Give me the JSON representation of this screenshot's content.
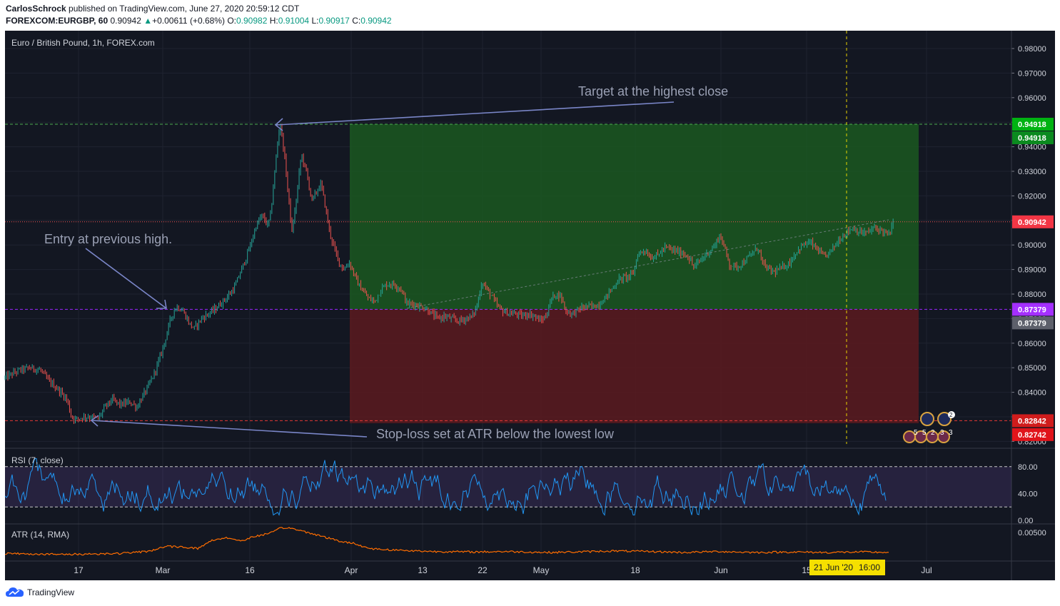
{
  "header": {
    "author": "CarlosSchrock",
    "published_text": "published on TradingView.com, June 27, 2020 20:59:12 CDT",
    "symbol": "FOREXCOM:EURGBP, 60",
    "last": "0.90942",
    "change": "+0.00611 (+0.68%)",
    "o_label": "O:",
    "o_value": "0.90982",
    "h_label": "H:",
    "h_value": "0.91004",
    "l_label": "L:",
    "l_value": "0.90917",
    "c_label": "C:",
    "c_value": "0.90942"
  },
  "chart_data": [
    {
      "type": "candlestick",
      "title": "Euro / British Pound, 1h, FOREX.com",
      "ylim": [
        0.818,
        0.985
      ],
      "y_ticks": [
        "0.98000",
        "0.97000",
        "0.96000",
        "0.95000",
        "0.94000",
        "0.93000",
        "0.92000",
        "0.91000",
        "0.90000",
        "0.89000",
        "0.88000",
        "0.87000",
        "0.86000",
        "0.85000",
        "0.84000",
        "0.83000",
        "0.82000"
      ],
      "x_ticks": [
        "17",
        "Mar",
        "16",
        "Apr",
        "13",
        "22",
        "May",
        "18",
        "Jun",
        "15",
        "Jul"
      ],
      "price_path": [
        [
          0,
          0.846
        ],
        [
          20,
          0.849
        ],
        [
          35,
          0.85
        ],
        [
          50,
          0.849
        ],
        [
          60,
          0.845
        ],
        [
          75,
          0.841
        ],
        [
          87,
          0.837
        ],
        [
          93,
          0.83
        ],
        [
          100,
          0.829
        ],
        [
          110,
          0.83
        ],
        [
          122,
          0.83
        ],
        [
          130,
          0.829
        ],
        [
          140,
          0.834
        ],
        [
          150,
          0.837
        ],
        [
          162,
          0.835
        ],
        [
          175,
          0.836
        ],
        [
          185,
          0.834
        ],
        [
          192,
          0.838
        ],
        [
          200,
          0.842
        ],
        [
          208,
          0.847
        ],
        [
          218,
          0.855
        ],
        [
          225,
          0.862
        ],
        [
          232,
          0.87
        ],
        [
          240,
          0.875
        ],
        [
          250,
          0.873
        ],
        [
          258,
          0.868
        ],
        [
          265,
          0.866
        ],
        [
          275,
          0.87
        ],
        [
          285,
          0.872
        ],
        [
          295,
          0.874
        ],
        [
          305,
          0.877
        ],
        [
          315,
          0.88
        ],
        [
          322,
          0.883
        ],
        [
          330,
          0.889
        ],
        [
          338,
          0.895
        ],
        [
          345,
          0.901
        ],
        [
          352,
          0.908
        ],
        [
          360,
          0.912
        ],
        [
          368,
          0.908
        ],
        [
          372,
          0.912
        ],
        [
          378,
          0.93
        ],
        [
          383,
          0.945
        ],
        [
          386,
          0.949
        ],
        [
          392,
          0.935
        ],
        [
          397,
          0.92
        ],
        [
          402,
          0.905
        ],
        [
          408,
          0.918
        ],
        [
          415,
          0.937
        ],
        [
          422,
          0.93
        ],
        [
          430,
          0.918
        ],
        [
          437,
          0.922
        ],
        [
          443,
          0.925
        ],
        [
          449,
          0.915
        ],
        [
          455,
          0.905
        ],
        [
          462,
          0.898
        ],
        [
          468,
          0.893
        ],
        [
          475,
          0.89
        ],
        [
          482,
          0.893
        ],
        [
          488,
          0.889
        ],
        [
          495,
          0.884
        ],
        [
          502,
          0.881
        ],
        [
          510,
          0.878
        ],
        [
          518,
          0.877
        ],
        [
          527,
          0.882
        ],
        [
          535,
          0.884
        ],
        [
          545,
          0.884
        ],
        [
          555,
          0.882
        ],
        [
          563,
          0.876
        ],
        [
          572,
          0.876
        ],
        [
          582,
          0.875
        ],
        [
          590,
          0.874
        ],
        [
          598,
          0.872
        ],
        [
          606,
          0.87
        ],
        [
          616,
          0.871
        ],
        [
          625,
          0.87
        ],
        [
          635,
          0.869
        ],
        [
          645,
          0.87
        ],
        [
          655,
          0.871
        ],
        [
          662,
          0.876
        ],
        [
          668,
          0.885
        ],
        [
          675,
          0.882
        ],
        [
          682,
          0.879
        ],
        [
          690,
          0.875
        ],
        [
          698,
          0.873
        ],
        [
          707,
          0.872
        ],
        [
          716,
          0.872
        ],
        [
          724,
          0.871
        ],
        [
          733,
          0.872
        ],
        [
          742,
          0.871
        ],
        [
          750,
          0.869
        ],
        [
          758,
          0.871
        ],
        [
          765,
          0.878
        ],
        [
          772,
          0.88
        ],
        [
          779,
          0.879
        ],
        [
          786,
          0.873
        ],
        [
          795,
          0.872
        ],
        [
          805,
          0.874
        ],
        [
          815,
          0.875
        ],
        [
          825,
          0.875
        ],
        [
          833,
          0.876
        ],
        [
          842,
          0.879
        ],
        [
          850,
          0.882
        ],
        [
          860,
          0.886
        ],
        [
          870,
          0.887
        ],
        [
          880,
          0.888
        ],
        [
          886,
          0.896
        ],
        [
          895,
          0.898
        ],
        [
          905,
          0.895
        ],
        [
          915,
          0.896
        ],
        [
          925,
          0.899
        ],
        [
          935,
          0.898
        ],
        [
          945,
          0.897
        ],
        [
          955,
          0.896
        ],
        [
          965,
          0.891
        ],
        [
          975,
          0.894
        ],
        [
          985,
          0.897
        ],
        [
          995,
          0.9
        ],
        [
          1001,
          0.904
        ],
        [
          1008,
          0.899
        ],
        [
          1015,
          0.892
        ],
        [
          1025,
          0.891
        ],
        [
          1035,
          0.893
        ],
        [
          1045,
          0.896
        ],
        [
          1055,
          0.899
        ],
        [
          1062,
          0.892
        ],
        [
          1070,
          0.89
        ],
        [
          1078,
          0.889
        ],
        [
          1090,
          0.891
        ],
        [
          1100,
          0.893
        ],
        [
          1108,
          0.897
        ],
        [
          1118,
          0.9
        ],
        [
          1128,
          0.901
        ],
        [
          1138,
          0.898
        ],
        [
          1148,
          0.895
        ],
        [
          1158,
          0.898
        ],
        [
          1168,
          0.902
        ],
        [
          1178,
          0.905
        ],
        [
          1188,
          0.907
        ],
        [
          1198,
          0.905
        ],
        [
          1208,
          0.905
        ],
        [
          1218,
          0.907
        ],
        [
          1228,
          0.906
        ],
        [
          1238,
          0.904
        ],
        [
          1245,
          0.909
        ]
      ]
    },
    {
      "type": "line",
      "title": "RSI (7, close)",
      "ylim": [
        0,
        100
      ],
      "y_ticks": [
        "80.00",
        "40.00",
        "0.00"
      ],
      "upper_band": 80,
      "lower_band": 20,
      "seed": 7
    },
    {
      "type": "line",
      "title": "ATR (14, RMA)",
      "y_ticks": [
        "0.00500"
      ],
      "atr_path": [
        [
          0,
          0.0008
        ],
        [
          80,
          0.0006
        ],
        [
          160,
          0.0008
        ],
        [
          200,
          0.0012
        ],
        [
          225,
          0.0022
        ],
        [
          250,
          0.0021
        ],
        [
          270,
          0.0018
        ],
        [
          290,
          0.0034
        ],
        [
          310,
          0.004
        ],
        [
          330,
          0.0033
        ],
        [
          350,
          0.0042
        ],
        [
          375,
          0.005
        ],
        [
          385,
          0.0058
        ],
        [
          395,
          0.006
        ],
        [
          410,
          0.0055
        ],
        [
          430,
          0.0048
        ],
        [
          450,
          0.004
        ],
        [
          470,
          0.0032
        ],
        [
          490,
          0.0028
        ],
        [
          510,
          0.0018
        ],
        [
          530,
          0.0016
        ],
        [
          560,
          0.0014
        ],
        [
          600,
          0.0012
        ],
        [
          660,
          0.0011
        ],
        [
          700,
          0.0012
        ],
        [
          760,
          0.001
        ],
        [
          800,
          0.0011
        ],
        [
          850,
          0.0013
        ],
        [
          900,
          0.0012
        ],
        [
          950,
          0.001
        ],
        [
          1000,
          0.0012
        ],
        [
          1050,
          0.001
        ],
        [
          1100,
          0.0011
        ],
        [
          1150,
          0.001
        ],
        [
          1200,
          0.0011
        ],
        [
          1245,
          0.001
        ]
      ]
    }
  ],
  "price_labels": {
    "target": "0.94918",
    "target_close": "0.94918",
    "current": "0.90942",
    "entry": "0.87379",
    "entry_close": "0.87379",
    "stop_close": "0.82842",
    "stop": "0.82742"
  },
  "levels": {
    "target": 0.94918,
    "current": 0.90942,
    "entry": 0.87379,
    "stop_close": 0.82842,
    "stop": 0.82742
  },
  "annotations": {
    "target": "Target at the highest close",
    "entry": "Entry at previous high.",
    "stop": "Stop-loss set at ATR below the lowest low"
  },
  "crosshair_date": "21 Jun '20",
  "crosshair_time": "16:00",
  "event_badges": [
    "5",
    "5",
    "2",
    "3",
    "3",
    "2"
  ],
  "footer": {
    "brand": "TradingView"
  },
  "colors": {
    "bg": "#131722",
    "up": "#26a69a",
    "down": "#ef5350",
    "target_green": "#008f2c",
    "entry_purple": "#8a1fff",
    "stop_red": "#e91e1e",
    "current_red": "#ef5350",
    "rsi": "#2196f3",
    "atr": "#ff6d00",
    "annotation": "#7a86c8"
  }
}
